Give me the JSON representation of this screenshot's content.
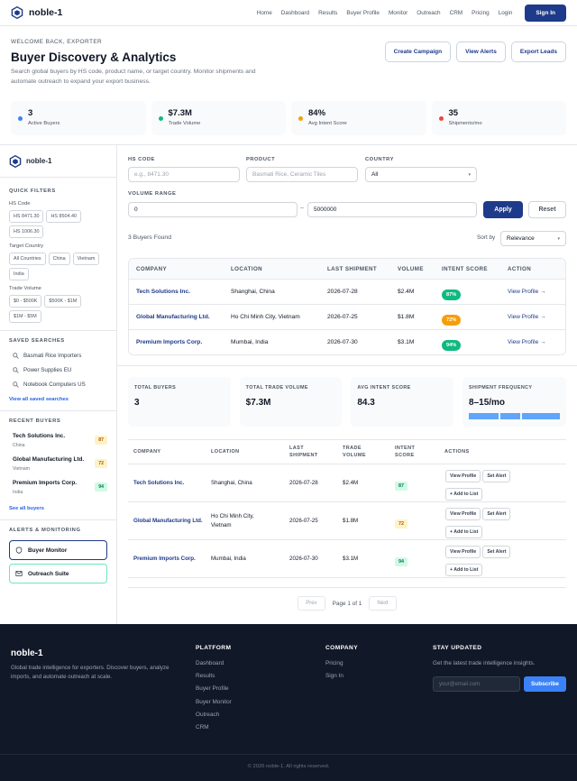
{
  "brand": "noble-1",
  "nav": {
    "links": [
      "Home",
      "Dashboard",
      "Results",
      "Buyer Profile",
      "Monitor",
      "Outreach",
      "CRM",
      "Pricing",
      "Login"
    ],
    "signin": "Sign In"
  },
  "hero": {
    "eyebrow": "WELCOME BACK, EXPORTER",
    "title": "Buyer Discovery & Analytics",
    "desc": "Search global buyers by HS code, product name, or target country. Monitor shipments and automate outreach to expand your export business.",
    "actions": [
      "Create Campaign",
      "View Alerts",
      "Export Leads"
    ],
    "stats": [
      {
        "value": "3",
        "label": "Active Buyers",
        "color": "#3b82f6"
      },
      {
        "value": "$7.3M",
        "label": "Trade Volume",
        "color": "#10b981"
      },
      {
        "value": "84%",
        "label": "Avg Intent Score",
        "color": "#f59e0b"
      },
      {
        "value": "35",
        "label": "Shipments/mo",
        "color": "#ef4444"
      }
    ]
  },
  "sidebar": {
    "brand": "noble-1",
    "quick_filters": "QUICK FILTERS",
    "hs_label": "HS Code",
    "hs_chips": [
      "HS 8471.30",
      "HS 8504.40",
      "HS 1006.30"
    ],
    "country_label": "Target Country",
    "country_chips": [
      "All Countries",
      "China",
      "Vietnam",
      "India"
    ],
    "volume_label": "Trade Volume",
    "volume_chips": [
      "$0 - $500K",
      "$500K - $1M",
      "$1M - $5M"
    ],
    "saved_title": "SAVED SEARCHES",
    "saved": [
      "Basmati Rice Importers",
      "Power Supplies EU",
      "Notebook Computers US"
    ],
    "saved_link": "View all saved searches",
    "recent_title": "RECENT BUYERS",
    "recent": [
      {
        "name": "Tech Solutions Inc.",
        "country": "China",
        "score": "87"
      },
      {
        "name": "Global Manufacturing Ltd.",
        "country": "Vietnam",
        "score": "72"
      },
      {
        "name": "Premium Imports Corp.",
        "country": "India",
        "score": "94"
      }
    ],
    "recent_link": "See all buyers",
    "alerts_title": "ALERTS & MONITORING",
    "alerts": [
      "Buyer Monitor",
      "Outreach Suite"
    ]
  },
  "filters": {
    "hs_label": "HS CODE",
    "hs_placeholder": "e.g., 8471.30",
    "product_label": "PRODUCT",
    "product_placeholder": "Basmati Rice, Ceramic Tiles",
    "country_label": "COUNTRY",
    "country_value": "All",
    "volume_label": "VOLUME RANGE",
    "volume_min": "0",
    "volume_sep": "–",
    "volume_max": "5000000",
    "apply": "Apply",
    "reset": "Reset"
  },
  "results": {
    "count": "3 Buyers Found",
    "sort_label": "Sort by",
    "sort_value": "Relevance",
    "headers": [
      "COMPANY",
      "LOCATION",
      "LAST SHIPMENT",
      "VOLUME",
      "INTENT SCORE",
      "ACTION"
    ],
    "rows": [
      {
        "company": "Tech Solutions Inc.",
        "location": "Shanghai, China",
        "date": "2026-07-28",
        "volume": "$2.4M",
        "score": "87%",
        "action": "View Profile →"
      },
      {
        "company": "Global Manufacturing Ltd.",
        "location": "Ho Chi Minh City, Vietnam",
        "date": "2026-07-25",
        "volume": "$1.8M",
        "score": "72%",
        "action": "View Profile →"
      },
      {
        "company": "Premium Imports Corp.",
        "location": "Mumbai, India",
        "date": "2026-07-30",
        "volume": "$3.1M",
        "score": "94%",
        "action": "View Profile →"
      }
    ]
  },
  "summary": [
    {
      "title": "TOTAL BUYERS",
      "value": "3"
    },
    {
      "title": "TOTAL TRADE VOLUME",
      "value": "$7.3M"
    },
    {
      "title": "AVG INTENT SCORE",
      "value": "84.3"
    },
    {
      "title": "SHIPMENT FREQUENCY",
      "value": "8–15/mo"
    }
  ],
  "detail": {
    "headers": [
      "COMPANY",
      "LOCATION",
      "LAST SHIPMENT",
      "TRADE VOLUME",
      "INTENT SCORE",
      "ACTIONS"
    ],
    "rows": [
      {
        "company": "Tech Solutions Inc.",
        "location": "Shanghai, China",
        "date": "2026-07-28",
        "volume": "$2.4M",
        "score": "87"
      },
      {
        "company": "Global Manufacturing Ltd.",
        "location": "Ho Chi Minh City, Vietnam",
        "date": "2026-07-25",
        "volume": "$1.8M",
        "score": "72"
      },
      {
        "company": "Premium Imports Corp.",
        "location": "Mumbai, India",
        "date": "2026-07-30",
        "volume": "$3.1M",
        "score": "94"
      }
    ],
    "actions": [
      "View Profile",
      "Set Alert",
      "+ Add to List"
    ],
    "pager_prev": "Prev",
    "pager_text": "Page 1 of 1",
    "pager_next": "Next"
  },
  "footer": {
    "brand": "noble-1",
    "desc": "Global trade intelligence for exporters. Discover buyers, analyze imports, and automate outreach at scale.",
    "platform_title": "PLATFORM",
    "platform": [
      "Dashboard",
      "Results",
      "Buyer Profile",
      "Buyer Monitor",
      "Outreach",
      "CRM"
    ],
    "company_title": "COMPANY",
    "company": [
      "Pricing",
      "Sign In"
    ],
    "updated_title": "STAY UPDATED",
    "updated_desc": "Get the latest trade intelligence insights.",
    "email_placeholder": "your@email.com",
    "subscribe": "Subscribe",
    "copyright": "© 2026 noble-1. All rights reserved."
  }
}
